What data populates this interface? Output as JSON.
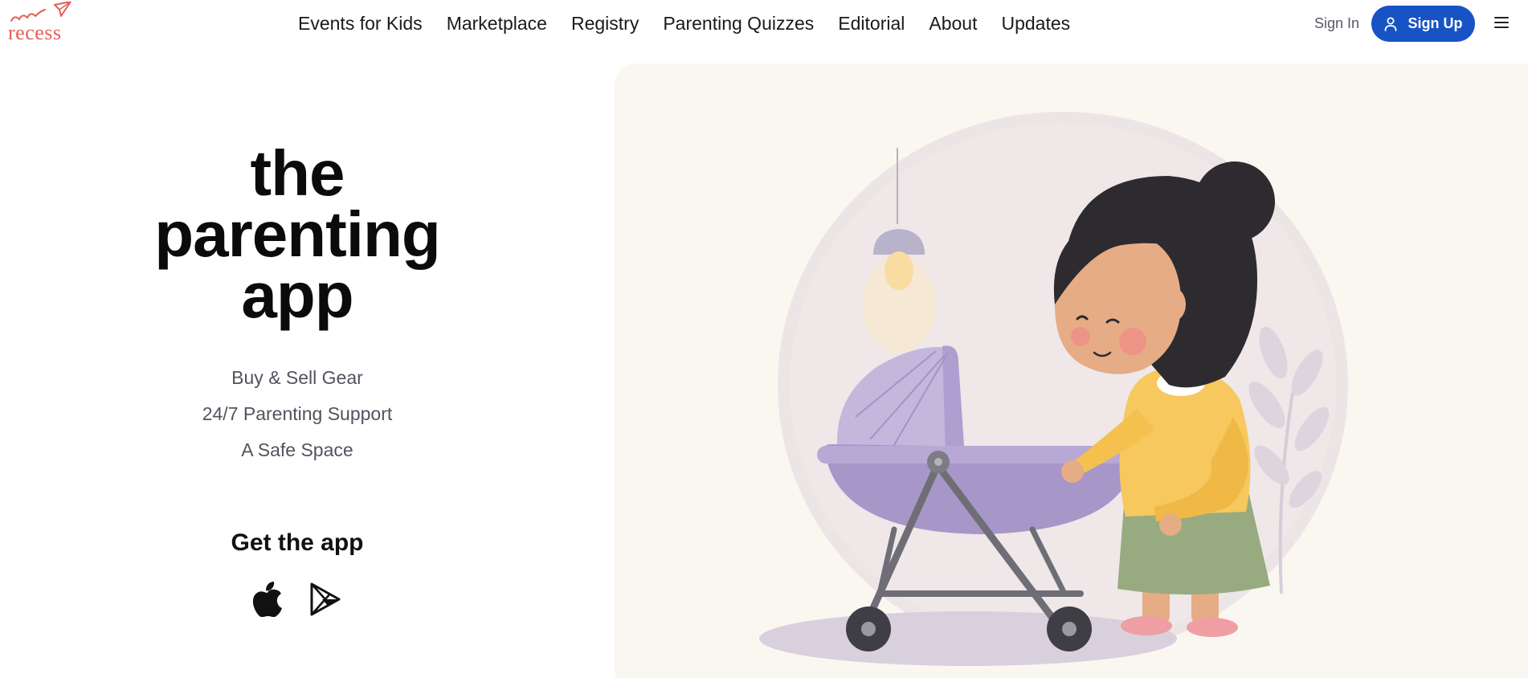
{
  "header": {
    "brand": "recess",
    "nav": [
      {
        "label": "Events for Kids"
      },
      {
        "label": "Marketplace"
      },
      {
        "label": "Registry"
      },
      {
        "label": "Parenting Quizzes"
      },
      {
        "label": "Editorial"
      },
      {
        "label": "About"
      },
      {
        "label": "Updates"
      }
    ],
    "sign_in_label": "Sign In",
    "sign_up_label": "Sign Up",
    "icons": {
      "user": "user-icon",
      "menu": "menu-icon"
    }
  },
  "hero": {
    "title_lines": [
      "the",
      "parenting",
      "app"
    ],
    "features": [
      "Buy & Sell Gear",
      "24/7 Parenting Support",
      "A Safe Space"
    ],
    "get_app_label": "Get the app",
    "store_icons": [
      "apple-icon",
      "google-play-icon"
    ],
    "illustration_icon": "girl-with-pram-illustration"
  },
  "colors": {
    "brand": "#e85d54",
    "accent": "#1753c4",
    "panel": "#faf7f1",
    "pram": "#a796c8",
    "sweater": "#f7c85d",
    "skirt": "#98ab80"
  }
}
